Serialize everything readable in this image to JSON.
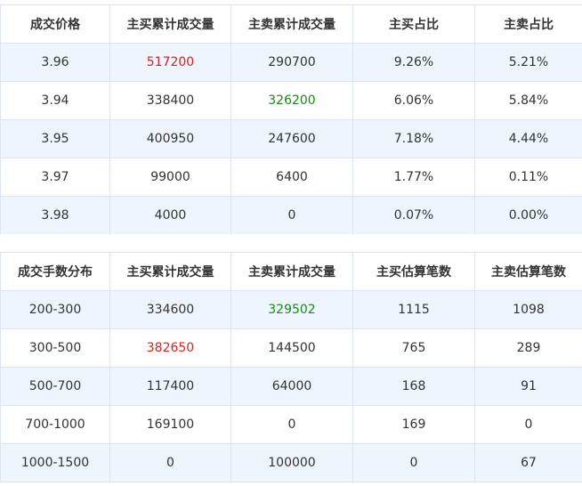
{
  "price_table": {
    "headers": [
      "成交价格",
      "主买累计成交量",
      "主卖累计成交量",
      "主买占比",
      "主卖占比"
    ],
    "rows": [
      {
        "price": "3.96",
        "buy_vol": "517200",
        "sell_vol": "290700",
        "buy_pct": "9.26%",
        "sell_pct": "5.21%",
        "buy_color": "red",
        "sell_color": ""
      },
      {
        "price": "3.94",
        "buy_vol": "338400",
        "sell_vol": "326200",
        "buy_pct": "6.06%",
        "sell_pct": "5.84%",
        "buy_color": "",
        "sell_color": "green"
      },
      {
        "price": "3.95",
        "buy_vol": "400950",
        "sell_vol": "247600",
        "buy_pct": "7.18%",
        "sell_pct": "4.44%",
        "buy_color": "",
        "sell_color": ""
      },
      {
        "price": "3.97",
        "buy_vol": "99000",
        "sell_vol": "6400",
        "buy_pct": "1.77%",
        "sell_pct": "0.11%",
        "buy_color": "",
        "sell_color": ""
      },
      {
        "price": "3.98",
        "buy_vol": "4000",
        "sell_vol": "0",
        "buy_pct": "0.07%",
        "sell_pct": "0.00%",
        "buy_color": "",
        "sell_color": ""
      }
    ]
  },
  "lot_table": {
    "headers": [
      "成交手数分布",
      "主买累计成交量",
      "主卖累计成交量",
      "主买估算笔数",
      "主卖估算笔数"
    ],
    "rows": [
      {
        "range": "200-300",
        "buy_vol": "334600",
        "sell_vol": "329502",
        "buy_cnt": "1115",
        "sell_cnt": "1098",
        "buy_color": "",
        "sell_color": "green"
      },
      {
        "range": "300-500",
        "buy_vol": "382650",
        "sell_vol": "144500",
        "buy_cnt": "765",
        "sell_cnt": "289",
        "buy_color": "red",
        "sell_color": ""
      },
      {
        "range": "500-700",
        "buy_vol": "117400",
        "sell_vol": "64000",
        "buy_cnt": "168",
        "sell_cnt": "91",
        "buy_color": "",
        "sell_color": ""
      },
      {
        "range": "700-1000",
        "buy_vol": "169100",
        "sell_vol": "0",
        "buy_cnt": "169",
        "sell_cnt": "0",
        "buy_color": "",
        "sell_color": ""
      },
      {
        "range": "1000-1500",
        "buy_vol": "0",
        "sell_vol": "100000",
        "buy_cnt": "0",
        "sell_cnt": "67",
        "buy_color": "",
        "sell_color": ""
      }
    ]
  },
  "colors": {
    "red": "#e02020",
    "green": "#1a8a1a",
    "row_alt": "#eef5fd",
    "border": "#dde6f0"
  }
}
